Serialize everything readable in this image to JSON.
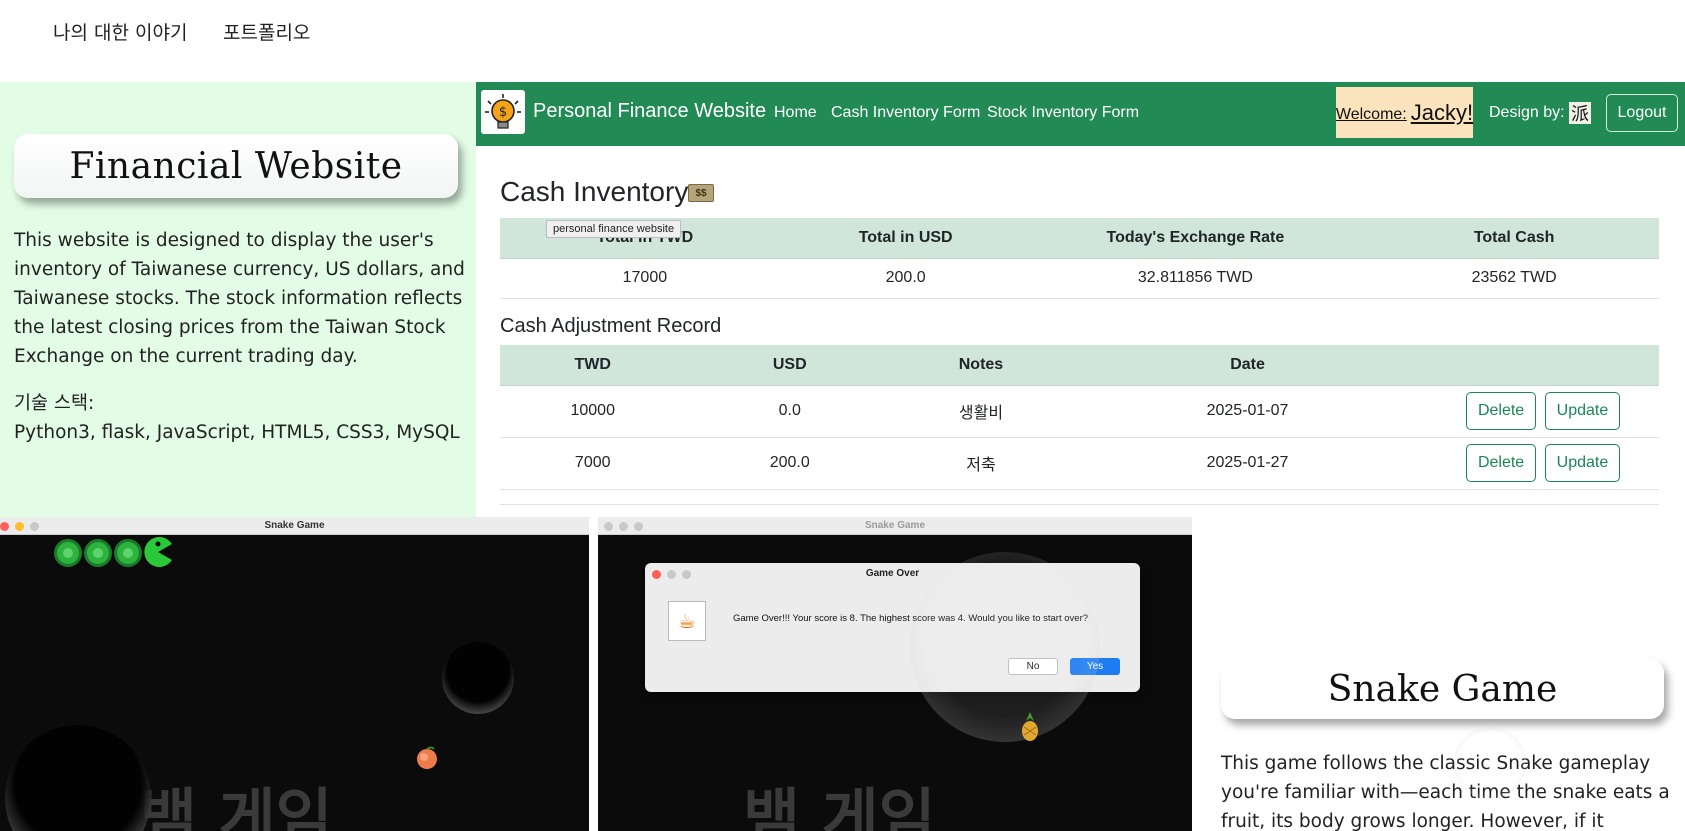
{
  "top_nav": {
    "about": "나의 대한 이야기",
    "portfolio": "포트폴리오"
  },
  "left_panel": {
    "title": "Financial Website",
    "description": "This website is designed to display the user's inventory of Taiwanese currency, US dollars, and Taiwanese stocks. The stock information reflects the latest closing prices from the Taiwan Stock Exchange on the current trading day.",
    "tech_label": "기술 스택:",
    "tech_stack": "Python3, flask, JavaScript, HTML5, CSS3, MySQL"
  },
  "site": {
    "brand": "Personal Finance Website",
    "nav": [
      "Home",
      "Cash Inventory Form",
      "Stock Inventory Form"
    ],
    "welcome_prefix": "Welcome:",
    "welcome_name": "Jacky!",
    "design_by": "Design by:",
    "design_mark": "派",
    "logout": "Logout",
    "cash_heading": "Cash Inventory",
    "money_icon": "money-icon",
    "tooltip": "personal finance website",
    "cash_table": {
      "headers": [
        "Total in TWD",
        "Total in USD",
        "Today's Exchange Rate",
        "Total Cash"
      ],
      "row": [
        "17000",
        "200.0",
        "32.811856 TWD",
        "23562 TWD"
      ]
    },
    "adjust_heading": "Cash Adjustment Record",
    "adjust_table": {
      "headers": [
        "TWD",
        "USD",
        "Notes",
        "Date",
        ""
      ],
      "rows": [
        [
          "10000",
          "0.0",
          "생활비",
          "2025-01-07"
        ],
        [
          "7000",
          "200.0",
          "저축",
          "2025-01-27"
        ]
      ],
      "delete_label": "Delete",
      "update_label": "Update"
    }
  },
  "game_left": {
    "title": "Snake Game",
    "bg_text": "뱀 게임"
  },
  "game_right": {
    "title": "Snake Game",
    "bg_text": "뱀 게임",
    "dialog_title": "Game Over",
    "dialog_message": "Game Over!!! Your score is 8. The highest score was 4. Would you like to start over?",
    "no_label": "No",
    "yes_label": "Yes"
  },
  "snake_section": {
    "title": "Snake Game",
    "description": "This game follows the classic Snake gameplay you're familiar with—each time the snake eats a fruit, its body grows longer. However, if it accidentally runs"
  },
  "colors": {
    "navbar": "#228a55",
    "header_row": "#d0e6da",
    "left_bg": "#e3fce6",
    "button": "#198754"
  }
}
